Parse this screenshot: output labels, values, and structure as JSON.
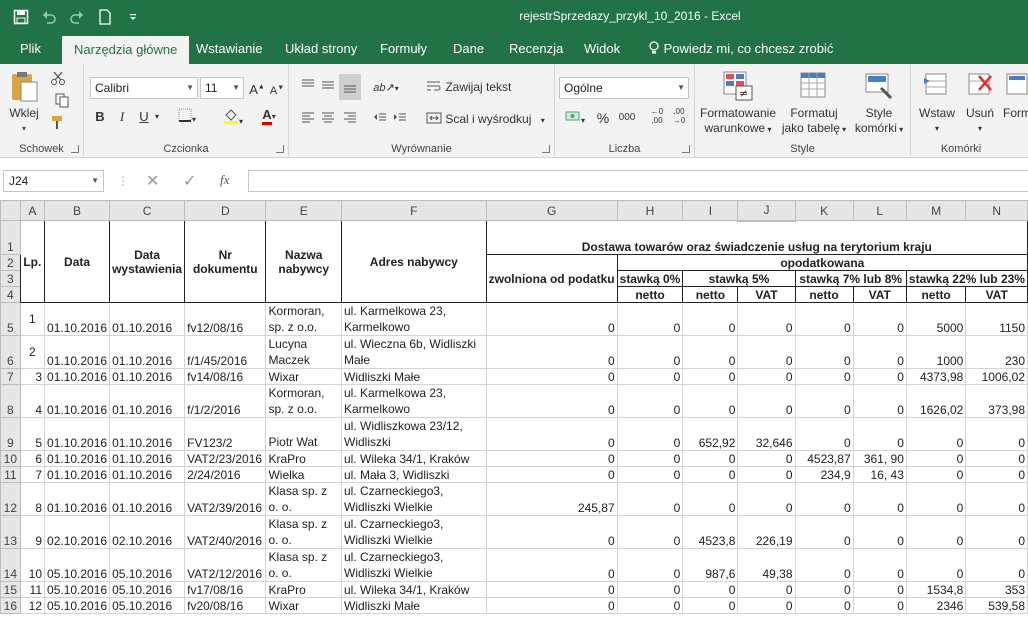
{
  "window": {
    "title": "rejestrSprzedazy_przykl_10_2016 - Excel"
  },
  "tabs": [
    "Plik",
    "Narzędzia główne",
    "Wstawianie",
    "Układ strony",
    "Formuły",
    "Dane",
    "Recenzja",
    "Widok"
  ],
  "tell_me": "Powiedz mi, co chcesz zrobić",
  "ribbon": {
    "clipboard": {
      "label": "Schowek",
      "paste": "Wklej"
    },
    "font": {
      "label": "Czcionka",
      "name": "Calibri",
      "size": "11",
      "bold": "B",
      "italic": "I",
      "underline": "U"
    },
    "alignment": {
      "label": "Wyrównanie",
      "wrap": "Zawijaj tekst",
      "merge": "Scal i wyśrodkuj"
    },
    "number": {
      "label": "Liczba",
      "format": "Ogólne",
      "percent": "%",
      "thousands": "000"
    },
    "styles": {
      "label": "Style",
      "conditional": "Formatowanie",
      "conditional2": "warunkowe",
      "table": "Formatuj",
      "table2": "jako tabelę",
      "cell": "Style",
      "cell2": "komórki"
    },
    "cells": {
      "label": "Komórki",
      "insert": "Wstaw",
      "delete": "Usuń",
      "format": "Form"
    }
  },
  "formula_bar": {
    "name_box": "J24",
    "fx": "fx",
    "value": ""
  },
  "columns": [
    "A",
    "B",
    "C",
    "D",
    "E",
    "F",
    "G",
    "H",
    "I",
    "J",
    "K",
    "L",
    "M",
    "N"
  ],
  "header": {
    "lp": "Lp.",
    "data": "Data",
    "data_wyst": "Data wystawienia",
    "nr_dok": "Nr dokumentu",
    "nazwa": "Nazwa nabywcy",
    "adres": "Adres nabywcy",
    "dostawa": "Dostawa towarów oraz świadczenie usług na terytorium kraju",
    "opodatkowana": "opodatkowana",
    "zwolniona": "zwolniona od podatku",
    "st0": "stawką 0%",
    "st5": "stawką 5%",
    "st78": "stawką 7% lub 8%",
    "st2223": "stawką 22% lub 23%",
    "netto": "netto",
    "vat": "VAT"
  },
  "row_numbers": [
    "1",
    "2",
    "3",
    "4"
  ],
  "rows": [
    {
      "r": "5",
      "lp": "1",
      "data": "01.10.2016",
      "wyst": "01.10.2016",
      "nr": "fv12/08/16",
      "nazwa": "Kormoran, sp. z o.o.",
      "adres": "ul. Karmelkowa 23, Karmelkowo",
      "g": "0",
      "h": "0",
      "i": "0",
      "j": "0",
      "k": "0",
      "l": "0",
      "m": "5000",
      "n": "1150"
    },
    {
      "r": "6",
      "lp": "2",
      "data": "01.10.2016",
      "wyst": "01.10.2016",
      "nr": "f/1/45/2016",
      "nazwa": "Lucyna Maczek",
      "adres": "ul. Wieczna 6b, Widliszki Małe",
      "g": "0",
      "h": "0",
      "i": "0",
      "j": "0",
      "k": "0",
      "l": "0",
      "m": "1000",
      "n": "230"
    },
    {
      "r": "7",
      "lp": "3",
      "data": "01.10.2016",
      "wyst": "01.10.2016",
      "nr": "fv14/08/16",
      "nazwa": "Wixar",
      "adres": "Widliszki Małe",
      "g": "0",
      "h": "0",
      "i": "0",
      "j": "0",
      "k": "0",
      "l": "0",
      "m": "4373,98",
      "n": "1006,02"
    },
    {
      "r": "8",
      "lp": "4",
      "data": "01.10.2016",
      "wyst": "01.10.2016",
      "nr": "f/1/2/2016",
      "nazwa": "Kormoran, sp. z o.o.",
      "adres": " ul. Karmelkowa 23, Karmelkowo",
      "g": "0",
      "h": "0",
      "i": "0",
      "j": "0",
      "k": "0",
      "l": "0",
      "m": "1626,02",
      "n": "373,98"
    },
    {
      "r": "9",
      "lp": "5",
      "data": "01.10.2016",
      "wyst": "01.10.2016",
      "nr": "FV123/2",
      "nazwa": "Piotr Wat",
      "adres": " ul. Widliszkowa 23/12, Widliszki",
      "g": "0",
      "h": "0",
      "i": "652,92",
      "j": "32,646",
      "k": "0",
      "l": "0",
      "m": "0",
      "n": "0"
    },
    {
      "r": "10",
      "lp": "6",
      "data": "01.10.2016",
      "wyst": "01.10.2016",
      "nr": "VAT2/23/2016",
      "nazwa": "KraPro",
      "adres": " ul. Wileka 34/1, Kraków",
      "g": "0",
      "h": "0",
      "i": "0",
      "j": "0",
      "k": "4523,87",
      "l": "361, 90",
      "m": "0",
      "n": "0"
    },
    {
      "r": "11",
      "lp": "7",
      "data": "01.10.2016",
      "wyst": "01.10.2016",
      "nr": "2/24/2016",
      "nazwa": "Wielka",
      "adres": " ul. Mała 3, Widliszki",
      "g": "0",
      "h": "0",
      "i": "0",
      "j": "0",
      "k": "234,9",
      "l": "16, 43",
      "m": "0",
      "n": "0"
    },
    {
      "r": "12",
      "lp": "8",
      "data": "01.10.2016",
      "wyst": "01.10.2016",
      "nr": "VAT2/39/2016",
      "nazwa": "Klasa sp. z o. o.",
      "adres": " ul. Czarneckiego3, Widliszki Wielkie",
      "g": "245,87",
      "h": "0",
      "i": "0",
      "j": "0",
      "k": "0",
      "l": "0",
      "m": "0",
      "n": "0"
    },
    {
      "r": "13",
      "lp": "9",
      "data": "02.10.2016",
      "wyst": "02.10.2016",
      "nr": "VAT2/40/2016",
      "nazwa": "Klasa sp. z o. o.",
      "adres": " ul. Czarneckiego3, Widliszki Wielkie",
      "g": "0",
      "h": "0",
      "i": "4523,8",
      "j": "226,19",
      "k": "0",
      "l": "0",
      "m": "0",
      "n": "0"
    },
    {
      "r": "14",
      "lp": "10",
      "data": "05.10.2016",
      "wyst": "05.10.2016",
      "nr": "VAT2/12/2016",
      "nazwa": "Klasa sp. z o. o.",
      "adres": " ul. Czarneckiego3, Widliszki Wielkie",
      "g": "0",
      "h": "0",
      "i": "987,6",
      "j": "49,38",
      "k": "0",
      "l": "0",
      "m": "0",
      "n": "0"
    },
    {
      "r": "15",
      "lp": "11",
      "data": "05.10.2016",
      "wyst": "05.10.2016",
      "nr": "fv17/08/16",
      "nazwa": "KraPro",
      "adres": " ul. Wileka 34/1, Kraków",
      "g": "0",
      "h": "0",
      "i": "0",
      "j": "0",
      "k": "0",
      "l": "0",
      "m": "1534,8",
      "n": "353"
    },
    {
      "r": "16",
      "lp": "12",
      "data": "05.10.2016",
      "wyst": "05.10.2016",
      "nr": "fv20/08/16",
      "nazwa": "Wixar",
      "adres": "  Widliszki Małe",
      "g": "0",
      "h": "0",
      "i": "0",
      "j": "0",
      "k": "0",
      "l": "0",
      "m": "2346",
      "n": "539,58"
    }
  ]
}
